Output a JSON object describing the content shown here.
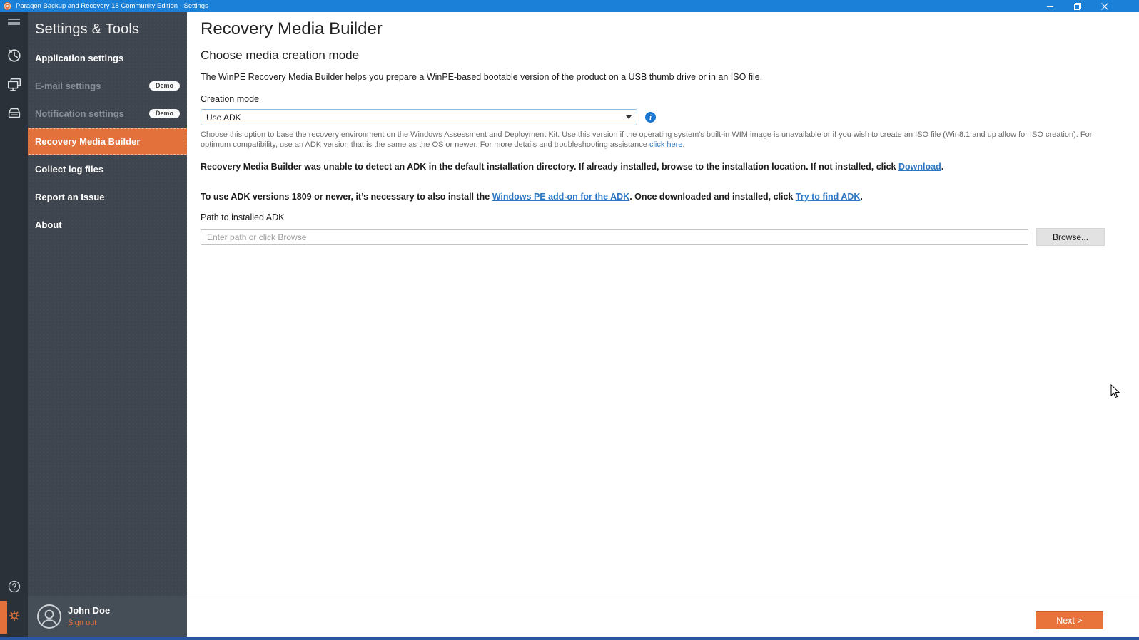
{
  "titlebar": {
    "title": "Paragon Backup and Recovery 18 Community Edition - Settings"
  },
  "sidebar": {
    "heading": "Settings & Tools",
    "items": [
      {
        "label": "Application settings"
      },
      {
        "label": "E-mail settings",
        "badge": "Demo"
      },
      {
        "label": "Notification settings",
        "badge": "Demo"
      },
      {
        "label": "Recovery Media Builder"
      },
      {
        "label": "Collect log files"
      },
      {
        "label": "Report an Issue"
      },
      {
        "label": "About"
      }
    ],
    "user": {
      "name": "John Doe",
      "signout": "Sign out"
    }
  },
  "main": {
    "title": "Recovery Media Builder",
    "subtitle": "Choose media creation mode",
    "intro": "The WinPE Recovery Media Builder helps you prepare a WinPE-based bootable version of the product on a USB thumb drive or in an ISO file.",
    "creation_mode": {
      "label": "Creation mode",
      "selected_value": "Use ADK",
      "description_part1": "Choose this option to base the recovery environment on the Windows Assessment and Deployment Kit. Use this version if the operating system's built-in WIM image is unavailable or if you wish to create an ISO file (Win8.1 and up allow for ISO creation). For optimum compatibility, use an ADK version that is the same as the OS or newer. For more details and troubleshooting assistance ",
      "description_link": "click here",
      "description_part2": "."
    },
    "warning": {
      "part1": "Recovery Media Builder was unable to detect an ADK in the default installation directory. If already installed, browse to the installation location. If not installed, click ",
      "link": "Download",
      "part2": "."
    },
    "addon": {
      "part1": "To use ADK versions 1809 or newer, it’s necessary to also install the ",
      "link1": "Windows PE add-on for the ADK",
      "part2": ". Once downloaded and installed, click ",
      "link2": "Try to find ADK",
      "part3": "."
    },
    "path": {
      "label": "Path to installed ADK",
      "value": "",
      "placeholder": "Enter path or click Browse",
      "browse_label": "Browse..."
    },
    "footer": {
      "next_label": "Next >"
    }
  },
  "colors": {
    "accent_orange": "#e2713c",
    "titlebar_blue": "#1b80d8",
    "link_blue": "#2e77c2",
    "rail_dark": "#2a3138",
    "sidebar_dark": "#3e454e"
  }
}
